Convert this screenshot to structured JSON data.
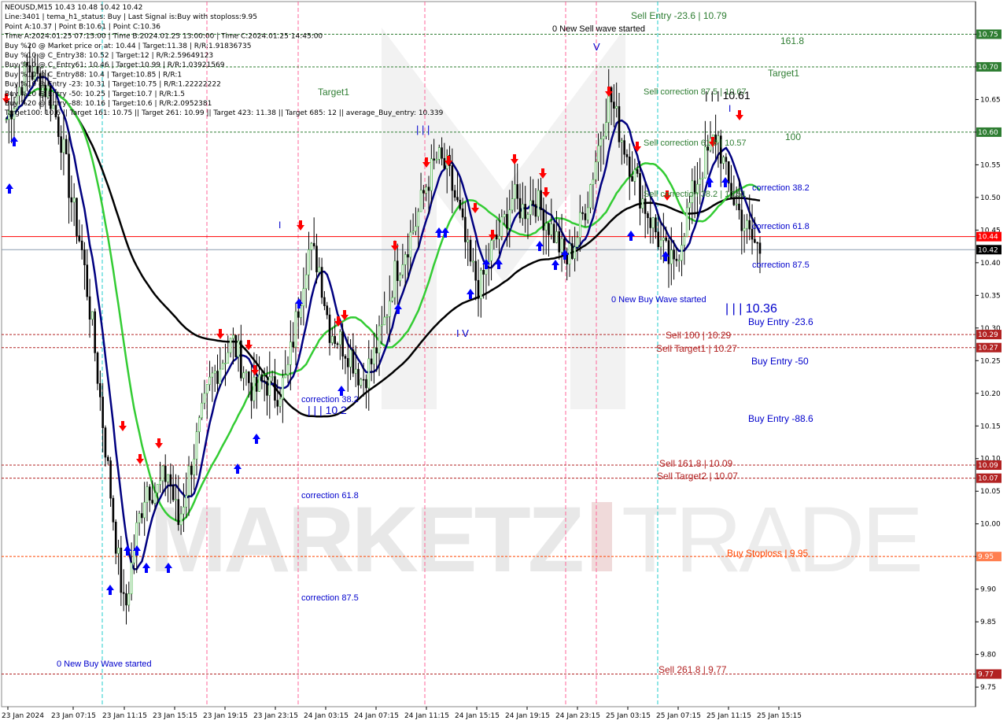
{
  "header": {
    "lines": [
      "NEOUSD,M15  10.43 10.48 10.42 10.42",
      "Line:3401 | tema_h1_status: Buy | Last Signal is:Buy with stoploss:9.95",
      "Point A:10.37 | Point B:10.61 | Point C:10.36",
      "Time A:2024.01.25 07:15:00 | Time B:2024.01.25 13:00:00 | Time C:2024.01.25 14:45:00",
      "Buy %20 @ Market price or at: 10.44 | Target:11.38 | R/R:1.91836735",
      "Buy %10 @ C_Entry38: 10.52 | Target:12 | R/R:2.59649123",
      "Buy %10 @ C_Entry61: 10.46 | Target:10.99 | R/R:1.03921569",
      "Buy %10 @ C_Entry88: 10.4 | Target:10.85 | R/R:1",
      "Buy %10 @ Entry -23: 10.31 | Target:10.75 | R/R:1.22222222",
      "Buy %20 @ Entry -50: 10.25 | Target:10.7 | R/R:1.5",
      "Buy %20 @ Entry -88: 10.16 | Target:10.6 | R/R:2.0952381",
      "Target100: 10.6 || Target 161: 10.75 || Target 261: 10.99 || Target 423: 11.38 || Target 685: 12 || average_Buy_entry: 10.339"
    ]
  },
  "watermark": {
    "left": "MARKETZ",
    "right": "TRADE"
  },
  "colors": {
    "buy": "#0000cc",
    "sell": "#b22222",
    "target": "#2e7d32",
    "neutral": "#1a237e",
    "ma_green": "#33cc33",
    "ma_navy": "#000080",
    "ma_black": "#000000",
    "grid": "#c8c8c8"
  },
  "chart_data": {
    "type": "candlestick",
    "symbol": "NEOUSD",
    "timeframe": "M15",
    "ylim": [
      9.72,
      10.8
    ],
    "price_ticks": [
      "9.75",
      "9.80",
      "9.85",
      "9.90",
      "9.95",
      "10.00",
      "10.05",
      "10.10",
      "10.15",
      "10.20",
      "10.25",
      "10.30",
      "10.35",
      "10.40",
      "10.45",
      "10.50",
      "10.55",
      "10.60",
      "10.65",
      "10.70",
      "10.75"
    ],
    "time_ticks": [
      "23 Jan 2024",
      "23 Jan 07:15",
      "23 Jan 11:15",
      "23 Jan 15:15",
      "23 Jan 19:15",
      "23 Jan 23:15",
      "24 Jan 03:15",
      "24 Jan 07:15",
      "24 Jan 11:15",
      "24 Jan 15:15",
      "24 Jan 19:15",
      "24 Jan 23:15",
      "25 Jan 03:15",
      "25 Jan 07:15",
      "25 Jan 11:15",
      "25 Jan 15:15"
    ],
    "close_path": [
      10.62,
      10.66,
      10.7,
      10.68,
      10.66,
      10.6,
      10.5,
      10.42,
      10.3,
      10.15,
      10.0,
      9.86,
      9.98,
      10.06,
      10.05,
      10.08,
      10.0,
      10.08,
      10.15,
      10.22,
      10.25,
      10.28,
      10.24,
      10.2,
      10.22,
      10.2,
      10.22,
      10.32,
      10.42,
      10.4,
      10.3,
      10.28,
      10.26,
      10.22,
      10.25,
      10.3,
      10.38,
      10.42,
      10.46,
      10.52,
      10.56,
      10.54,
      10.48,
      10.4,
      10.36,
      10.42,
      10.45,
      10.5,
      10.48,
      10.5,
      10.47,
      10.44,
      10.4,
      10.44,
      10.5,
      10.58,
      10.66,
      10.6,
      10.55,
      10.5,
      10.46,
      10.42,
      10.39,
      10.46,
      10.52,
      10.56,
      10.6,
      10.52,
      10.48,
      10.44,
      10.42
    ],
    "levels": [
      {
        "price": "10.75",
        "label": "161.8",
        "color": "#2e7d32",
        "style": "dash"
      },
      {
        "price": "10.70",
        "label": "Target1",
        "color": "#2e7d32",
        "style": "dash"
      },
      {
        "price": "10.60",
        "label": "100",
        "color": "#2e7d32",
        "style": "dash"
      },
      {
        "price": "10.44",
        "label": "",
        "color": "#ff0000",
        "style": "solid"
      },
      {
        "price": "10.42",
        "label": "",
        "color": "#8a9bb0",
        "style": "solid"
      },
      {
        "price": "10.29",
        "label": "Sell 100 | 10.29",
        "color": "#b22222",
        "style": "dash"
      },
      {
        "price": "10.27",
        "label": "Sell Target1 | 10.27",
        "color": "#b22222",
        "style": "dash"
      },
      {
        "price": "10.09",
        "label": "Sell 161.8 | 10.09",
        "color": "#b22222",
        "style": "dash"
      },
      {
        "price": "10.07",
        "label": "Sell Target2 | 10.07",
        "color": "#b22222",
        "style": "dash"
      },
      {
        "price": "9.95",
        "label": "Buy Stoploss | 9.95",
        "color": "#ff4500",
        "style": "dash"
      },
      {
        "price": "9.77",
        "label": "Sell 261.8 | 9.77",
        "color": "#b22222",
        "style": "dash"
      }
    ],
    "right_axis_tags": [
      {
        "price": "10.75",
        "bg": "#2e7d32"
      },
      {
        "price": "10.70",
        "bg": "#2e7d32"
      },
      {
        "price": "10.60",
        "bg": "#2e7d32"
      },
      {
        "price": "10.44",
        "bg": "#ff0000"
      },
      {
        "price": "10.42",
        "bg": "#000000"
      },
      {
        "price": "10.29",
        "bg": "#b22222"
      },
      {
        "price": "10.27",
        "bg": "#b22222"
      },
      {
        "price": "10.09",
        "bg": "#b22222"
      },
      {
        "price": "10.07",
        "bg": "#b22222"
      },
      {
        "price": "9.95",
        "bg": "#ff7f50"
      },
      {
        "price": "9.77",
        "bg": "#b22222"
      }
    ],
    "annotations": [
      {
        "text": "Sell Entry -23.6 | 10.79",
        "color": "#2e7d32"
      },
      {
        "text": "0 New Sell wave started",
        "color": "#000000"
      },
      {
        "text": "161.8",
        "color": "#2e7d32"
      },
      {
        "text": "Target1",
        "color": "#2e7d32"
      },
      {
        "text": "Target1",
        "color": "#2e7d32"
      },
      {
        "text": "Sell correction 87.5 | 10.67",
        "color": "#2e7d32"
      },
      {
        "text": "| | | 10.61",
        "color": "#000000"
      },
      {
        "text": "100",
        "color": "#2e7d32"
      },
      {
        "text": "Sell correction 61.8 | 10.57",
        "color": "#2e7d32"
      },
      {
        "text": "Sell correction 38.2 | 10.51",
        "color": "#2e7d32"
      },
      {
        "text": "correction 38.2",
        "color": "#0000cc"
      },
      {
        "text": "correction 61.8",
        "color": "#0000cc"
      },
      {
        "text": "correction 87.5",
        "color": "#0000cc"
      },
      {
        "text": "0 New Buy Wave started",
        "color": "#0000cc"
      },
      {
        "text": "| | | 10.36",
        "color": "#0000cc"
      },
      {
        "text": "Buy Entry -23.6",
        "color": "#0000cc"
      },
      {
        "text": "Sell 100 | 10.29",
        "color": "#b22222"
      },
      {
        "text": "Sell Target1 | 10.27",
        "color": "#b22222"
      },
      {
        "text": "Buy Entry -50",
        "color": "#0000cc"
      },
      {
        "text": "Buy Entry -88.6",
        "color": "#0000cc"
      },
      {
        "text": "Sell 161.8 | 10.09",
        "color": "#b22222"
      },
      {
        "text": "Sell Target2 | 10.07",
        "color": "#b22222"
      },
      {
        "text": "Buy Stoploss | 9.95",
        "color": "#ff4500"
      },
      {
        "text": "Sell 261.8 | 9.77",
        "color": "#b22222"
      },
      {
        "text": "correction 38.2",
        "color": "#0000cc"
      },
      {
        "text": "| | | 10.2",
        "color": "#0000cc"
      },
      {
        "text": "correction 61.8",
        "color": "#0000cc"
      },
      {
        "text": "correction 87.5",
        "color": "#0000cc"
      },
      {
        "text": "0 New Buy Wave started",
        "color": "#0000cc"
      },
      {
        "text": "| | |",
        "color": "#0000cc"
      },
      {
        "text": "I V",
        "color": "#0000cc"
      },
      {
        "text": "V",
        "color": "#0000cc"
      },
      {
        "text": "I",
        "color": "#0000cc"
      },
      {
        "text": "I",
        "color": "#0000cc"
      }
    ]
  }
}
